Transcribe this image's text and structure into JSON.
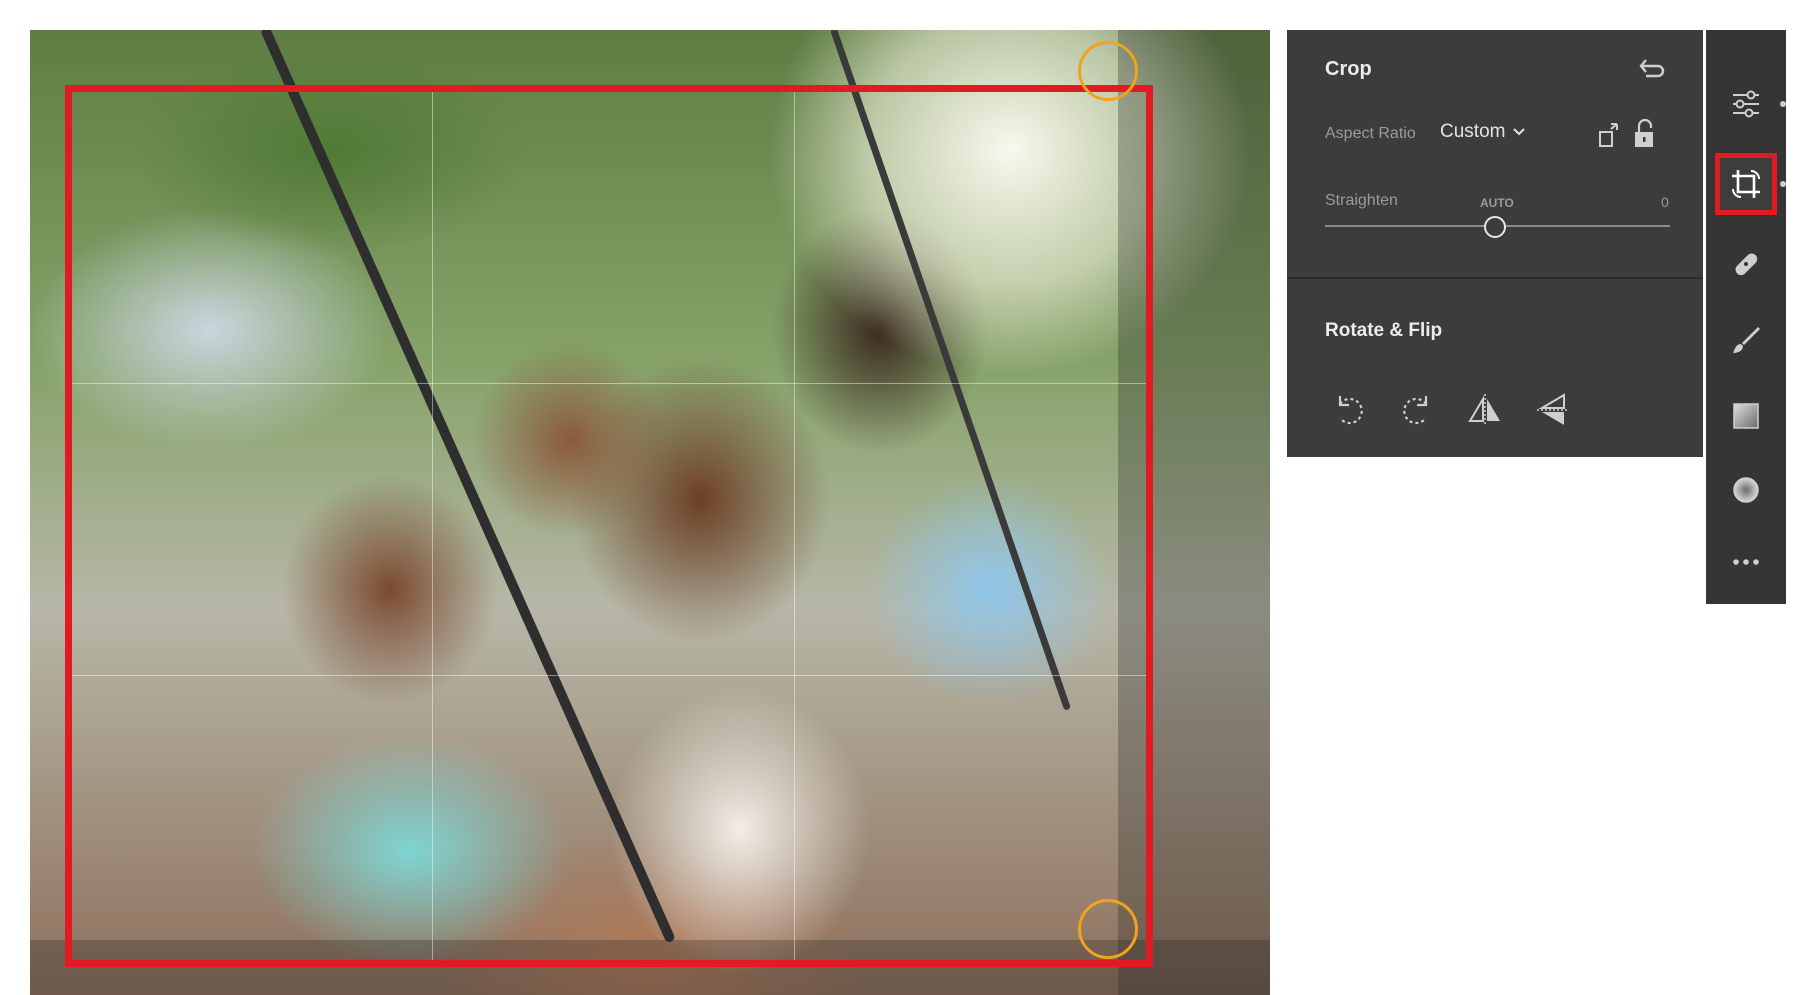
{
  "crop_panel": {
    "title": "Crop",
    "aspect_ratio_label": "Aspect Ratio",
    "aspect_ratio_value": "Custom",
    "straighten_label": "Straighten",
    "straighten_auto": "AUTO",
    "straighten_value": "0",
    "rotate_flip_title": "Rotate & Flip"
  },
  "icons": {
    "reset": "undo-icon",
    "orientation": "swap-orientation-icon",
    "lock": "unlock-icon",
    "rotate_left": "rotate-left-icon",
    "rotate_right": "rotate-right-icon",
    "flip_horizontal": "flip-horizontal-icon",
    "flip_vertical": "flip-vertical-icon"
  },
  "toolbar": {
    "tools": [
      "edit-sliders-icon",
      "crop-icon",
      "healing-icon",
      "brush-icon",
      "linear-gradient-icon",
      "radial-gradient-icon",
      "more-icon"
    ],
    "active_tool": "crop-icon"
  },
  "colors": {
    "highlight": "#e01b24",
    "handle": "#f0a41e",
    "panel_bg": "#3c3c3c",
    "toolbar_bg": "#353535"
  }
}
